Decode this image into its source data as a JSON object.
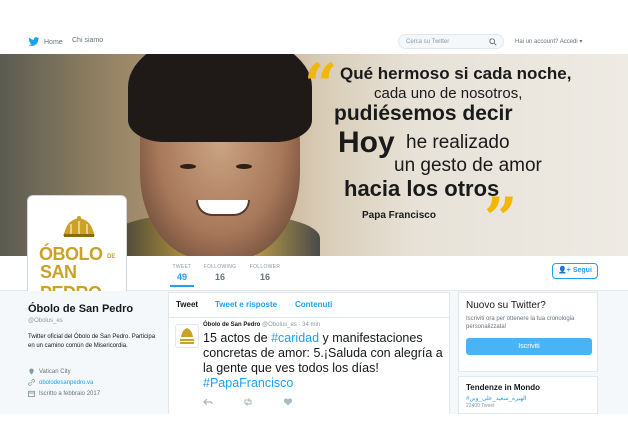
{
  "nav": {
    "home": "Home",
    "about": "Chi siamo",
    "search_placeholder": "Cerca su Twitter",
    "account": "Hai un account? Accedi"
  },
  "banner": {
    "quote_lines": [
      "Qué hermoso si cada noche,",
      "cada uno de nosotros,",
      "pudiésemos decir",
      "Hoy",
      "he realizado",
      "un gesto de amor",
      "hacia los otros"
    ],
    "author": "Papa Francisco"
  },
  "logo": {
    "line1": "ÓBOLO",
    "de": "DE",
    "line2": "SAN PEDRO"
  },
  "stats": [
    {
      "label": "TWEET",
      "value": "49"
    },
    {
      "label": "FOLLOWING",
      "value": "16"
    },
    {
      "label": "FOLLOWER",
      "value": "16"
    }
  ],
  "follow_button": "Segui",
  "profile": {
    "name": "Óbolo de San Pedro",
    "handle": "@Obolus_es",
    "bio": "Twitter oficial del Óbolo de San Pedro. Participa en un camino común de Misericordia.",
    "location": "Vatican City",
    "website": "obolodesanpedro.va",
    "joined": "Iscritto a febbraio 2017"
  },
  "tabs": [
    "Tweet",
    "Tweet e risposte",
    "Contenuti"
  ],
  "tweet": {
    "author": "Óbolo de San Pedro",
    "handle": "@Obolus_es",
    "time": "· 34 min",
    "parts": [
      {
        "text": "15 actos de ",
        "hl": false
      },
      {
        "text": "#caridad",
        "hl": true
      },
      {
        "text": " y manifestaciones concretas de amor: 5.¡Saluda con alegría a la gente que ves todos los días! ",
        "hl": false
      },
      {
        "text": "#PapaFrancisco",
        "hl": true
      }
    ]
  },
  "signup_card": {
    "title": "Nuovo su Twitter?",
    "subtitle": "Iscriviti ora per ottenere la tua cronologia personalizzata!",
    "button": "Iscriviti"
  },
  "trends": {
    "title": "Tendenze in Mondo",
    "item": "#الهيره_سعيد_على_وين",
    "count": "22400 Tweet"
  },
  "colors": {
    "accent": "#1da1f2",
    "logo_gold": "#c9a227",
    "quote_gold": "#f2b705"
  }
}
